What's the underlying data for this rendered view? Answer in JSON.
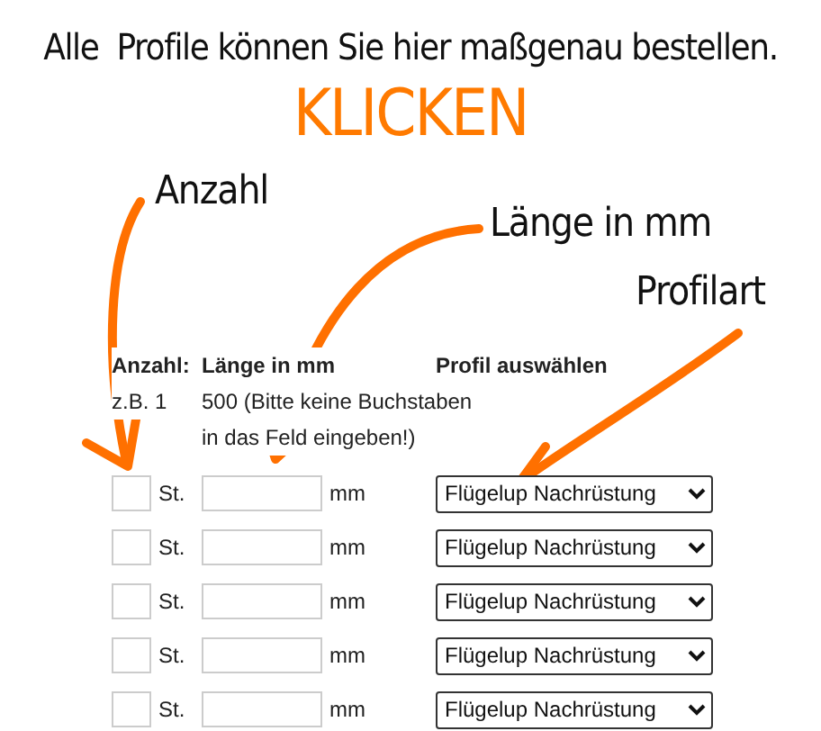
{
  "headline": "Alle  Profile können Sie hier maßgenau bestellen.",
  "call_to_action": "KLICKEN",
  "annotations": [
    {
      "label": "Anzahl"
    },
    {
      "label": "Länge in mm"
    },
    {
      "label": "Profilart"
    }
  ],
  "table": {
    "columns": [
      "Anzahl:",
      "Länge in mm",
      "Profil auswählen"
    ],
    "example": {
      "quantity": "z.B. 1",
      "length": "500 (Bitte keine Buchstaben in das Feld eingeben!)"
    },
    "rows": [
      {
        "quantity_unit": "St.",
        "length_unit": "mm",
        "profile": "Flügelup Nachrüstung"
      },
      {
        "quantity_unit": "St.",
        "length_unit": "mm",
        "profile": "Flügelup Nachrüstung"
      },
      {
        "quantity_unit": "St.",
        "length_unit": "mm",
        "profile": "Flügelup Nachrüstung"
      },
      {
        "quantity_unit": "St.",
        "length_unit": "mm",
        "profile": "Flügelup Nachrüstung"
      },
      {
        "quantity_unit": "St.",
        "length_unit": "mm",
        "profile": "Flügelup Nachrüstung"
      }
    ]
  }
}
